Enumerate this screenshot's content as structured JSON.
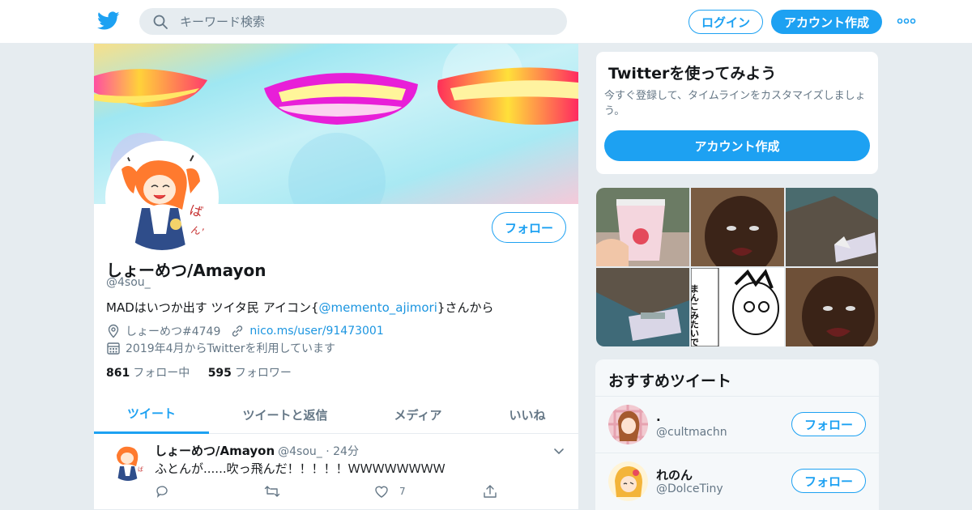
{
  "topbar": {
    "search_placeholder": "キーワード検索",
    "login_label": "ログイン",
    "signup_label": "アカウント作成"
  },
  "profile": {
    "follow_label": "フォロー",
    "name": "しょーめつ/Amayon",
    "handle": "@4sou_",
    "bio_prefix": "MADはいつか出す ツイタ民 アイコン{",
    "bio_link": "@memento_ajimori",
    "bio_suffix": "}さんから",
    "location": "しょーめつ#4749",
    "website": "nico.ms/user/91473001",
    "joined": "2019年4月からTwitterを利用しています",
    "following_count": "861",
    "following_label": "フォロー中",
    "followers_count": "595",
    "followers_label": "フォロワー"
  },
  "tabs": [
    {
      "label": "ツイート",
      "active": true
    },
    {
      "label": "ツイートと返信",
      "active": false
    },
    {
      "label": "メディア",
      "active": false
    },
    {
      "label": "いいね",
      "active": false
    }
  ],
  "tweet": {
    "name": "しょーめつ/Amayon",
    "handle": "@4sou_",
    "time": "24分",
    "text": "ふとんが......吹っ飛んだ！！！！！ＷＷＷＷＷＷＷＷ",
    "like_count": "7"
  },
  "signup_card": {
    "title": "Twitterを使ってみよう",
    "description": "今すぐ登録して、タイムラインをカスタマイズしましょう。",
    "button_label": "アカウント作成"
  },
  "media": {
    "manga_text": "まんこみたいです！"
  },
  "recommend": {
    "title": "おすすめツイート",
    "items": [
      {
        "name": ".",
        "handle": "@cultmachn",
        "button": "フォロー"
      },
      {
        "name": "れのん",
        "handle": "@DolceTiny",
        "button": "フォロー"
      }
    ]
  },
  "colors": {
    "accent": "#1da1f2",
    "text_secondary": "#657786",
    "background": "#e6ecf0"
  }
}
